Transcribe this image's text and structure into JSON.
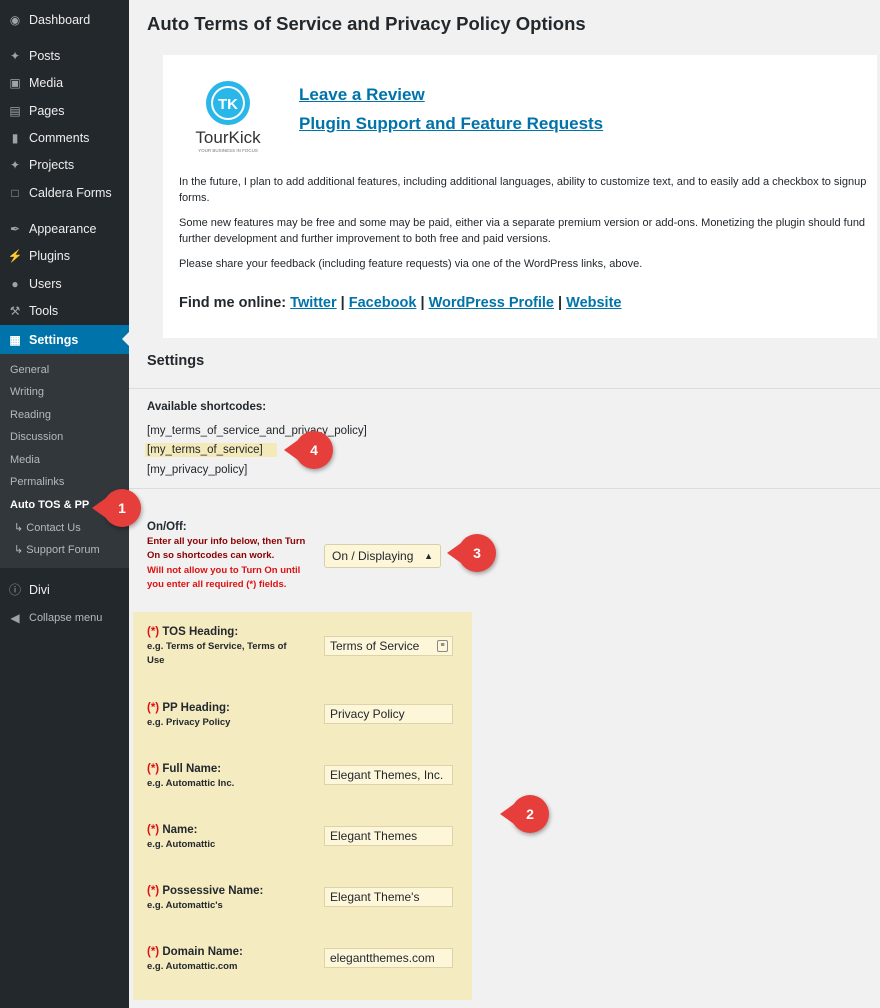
{
  "page": {
    "title": "Auto Terms of Service and Privacy Policy Options"
  },
  "sidebar": {
    "items": [
      {
        "label": "Dashboard",
        "icon": "dashboard-icon"
      },
      {
        "label": "Posts",
        "icon": "pin-icon"
      },
      {
        "label": "Media",
        "icon": "media-icon"
      },
      {
        "label": "Pages",
        "icon": "pages-icon"
      },
      {
        "label": "Comments",
        "icon": "comment-icon"
      },
      {
        "label": "Projects",
        "icon": "pin-icon"
      },
      {
        "label": "Caldera Forms",
        "icon": "caldera-icon"
      },
      {
        "label": "Appearance",
        "icon": "brush-icon"
      },
      {
        "label": "Plugins",
        "icon": "plug-icon"
      },
      {
        "label": "Users",
        "icon": "user-icon"
      },
      {
        "label": "Tools",
        "icon": "wrench-icon"
      },
      {
        "label": "Settings",
        "icon": "settings-icon"
      }
    ],
    "submenu": [
      "General",
      "Writing",
      "Reading",
      "Discussion",
      "Media",
      "Permalinks",
      "Auto TOS & PP"
    ],
    "submenu_children": [
      "Contact Us",
      "Support Forum"
    ],
    "divi": "Divi",
    "collapse": "Collapse menu"
  },
  "promo": {
    "logo_text": "TourKick",
    "logo_tagline": "YOUR BUSINESS IN FOCUS",
    "logo_mark": "TK",
    "review_link": "Leave a Review",
    "support_link": "Plugin Support and Feature Requests",
    "para1": "In the future, I plan to add additional features, including additional languages, ability to customize text, and to easily add a checkbox to signup forms.",
    "para2": "Some new features may be free and some may be paid, either via a separate premium version or add-ons. Monetizing the plugin should fund further development and further improvement to both free and paid versions.",
    "para3": "Please share your feedback (including feature requests) via one of the WordPress links, above.",
    "find_me": "Find me online:",
    "links": [
      "Twitter",
      "Facebook",
      "WordPress Profile",
      "Website"
    ],
    "separator": "|"
  },
  "settings": {
    "heading": "Settings",
    "shortcodes_label": "Available shortcodes:",
    "shortcodes": [
      "[my_terms_of_service_and_privacy_policy]",
      "[my_terms_of_service]",
      "[my_privacy_policy]"
    ],
    "onoff_label": "On/Off:",
    "onoff_help1": "Enter all your info below, then Turn On so shortcodes can work.",
    "onoff_help2": "Will not allow you to Turn On until you enter all required (*) fields.",
    "onoff_value": "On / Displaying"
  },
  "fields": [
    {
      "req": "(*)",
      "label": "TOS Heading:",
      "example": "e.g. Terms of Service, Terms of Use",
      "value": "Terms of Service"
    },
    {
      "req": "(*)",
      "label": "PP Heading:",
      "example": "e.g. Privacy Policy",
      "value": "Privacy Policy"
    },
    {
      "req": "(*)",
      "label": "Full Name:",
      "example": "e.g. Automattic Inc.",
      "value": "Elegant Themes, Inc."
    },
    {
      "req": "(*)",
      "label": "Name:",
      "example": "e.g. Automattic",
      "value": "Elegant Themes"
    },
    {
      "req": "(*)",
      "label": "Possessive Name:",
      "example": "e.g. Automattic's",
      "value": "Elegant Theme's"
    },
    {
      "req": "(*)",
      "label": "Domain Name:",
      "example": "e.g. Automattic.com",
      "value": "elegantthemes.com"
    }
  ],
  "callouts": [
    "1",
    "2",
    "3",
    "4"
  ],
  "colors": {
    "sidebar_bg": "#23282d",
    "submenu_bg": "#32373c",
    "accent": "#0073aa",
    "highlight": "#f5ebc1",
    "callout": "#e63e3a",
    "required": "#dd1111"
  }
}
